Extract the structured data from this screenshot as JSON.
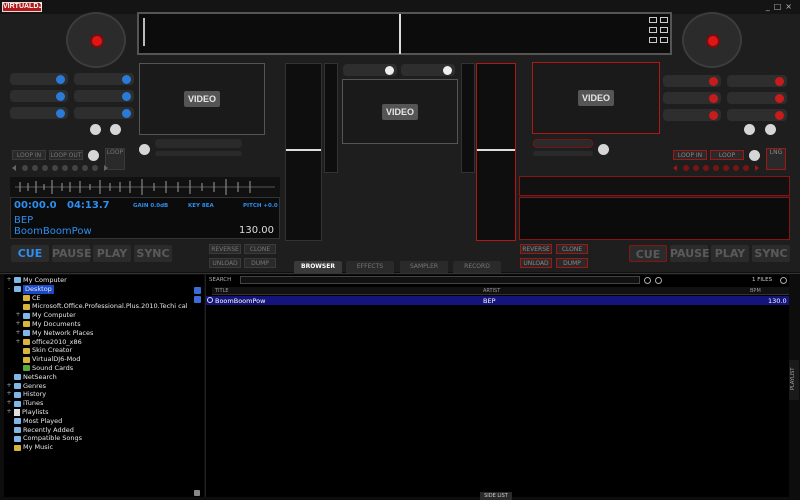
{
  "app": {
    "logo": "VIRTUALDJ",
    "window_controls": [
      "_",
      "□",
      "×"
    ]
  },
  "video_label": "VIDEO",
  "deck_left": {
    "elapsed": "00:00.0",
    "remain": "04:13.7",
    "gain": "GAIN 0.0dB",
    "key": "KEY 8EA",
    "pitch": "PITCH +0.0",
    "artist": "BEP",
    "title": "BoomBoomPow",
    "bpm": "130.00",
    "loop_in": "LOOP IN",
    "loop_out": "LOOP OUT",
    "loop": "LOOP",
    "reverse": "REVERSE",
    "clone": "CLONE",
    "unload": "UNLOAD",
    "dump": "DUMP",
    "cue": "CUE",
    "pause": "PAUSE",
    "play": "PLAY",
    "sync": "SYNC"
  },
  "deck_right": {
    "loop_in": "LOOP IN",
    "loop": "LOOP",
    "lng": "LNG",
    "reverse": "REVERSE",
    "clone": "CLONE",
    "unload": "UNLOAD",
    "dump": "DUMP",
    "cue": "CUE",
    "pause": "PAUSE",
    "play": "PLAY",
    "sync": "SYNC"
  },
  "tabs": [
    "BROWSER",
    "EFFECTS",
    "SAMPLER",
    "RECORD"
  ],
  "search": {
    "label": "SEARCH",
    "value": "",
    "files": "1 FILES"
  },
  "columns": [
    "TITLE",
    "ARTIST",
    "BPM"
  ],
  "rows": [
    {
      "title": "BoomBoomPow",
      "artist": "BEP",
      "bpm": "130.0"
    }
  ],
  "tree": [
    {
      "label": "My Computer",
      "indent": 0,
      "icon": "pc",
      "exp": "+"
    },
    {
      "label": "Desktop",
      "indent": 0,
      "icon": "pc",
      "exp": "-",
      "selected": true
    },
    {
      "label": "CE",
      "indent": 1,
      "icon": "folder",
      "exp": ""
    },
    {
      "label": "Microsoft.Office.Professional.Plus.2010.Techi cal",
      "indent": 1,
      "icon": "folder",
      "exp": ""
    },
    {
      "label": "My Computer",
      "indent": 1,
      "icon": "pc",
      "exp": "+"
    },
    {
      "label": "My Documents",
      "indent": 1,
      "icon": "folder",
      "exp": "+"
    },
    {
      "label": "My Network Places",
      "indent": 1,
      "icon": "pc",
      "exp": "+"
    },
    {
      "label": "office2010_x86",
      "indent": 1,
      "icon": "folder",
      "exp": "+"
    },
    {
      "label": "Skin Creator",
      "indent": 1,
      "icon": "folder",
      "exp": ""
    },
    {
      "label": "VirtualDJ6-Mod",
      "indent": 1,
      "icon": "folder",
      "exp": ""
    },
    {
      "label": "Sound Cards",
      "indent": 1,
      "icon": "green",
      "exp": ""
    },
    {
      "label": "NetSearch",
      "indent": 0,
      "icon": "pc",
      "exp": ""
    },
    {
      "label": "Genres",
      "indent": 0,
      "icon": "pc",
      "exp": "+"
    },
    {
      "label": "History",
      "indent": 0,
      "icon": "pc",
      "exp": "+"
    },
    {
      "label": "iTunes",
      "indent": 0,
      "icon": "pc",
      "exp": "+"
    },
    {
      "label": "Playlists",
      "indent": 0,
      "icon": "list",
      "exp": "+"
    },
    {
      "label": "Most Played",
      "indent": 0,
      "icon": "pc",
      "exp": ""
    },
    {
      "label": "Recently Added",
      "indent": 0,
      "icon": "pc",
      "exp": ""
    },
    {
      "label": "Compatible Songs",
      "indent": 0,
      "icon": "pc",
      "exp": ""
    },
    {
      "label": "My Music",
      "indent": 0,
      "icon": "folder",
      "exp": ""
    }
  ],
  "playlist_label": "PLAYLIST",
  "sidelist_label": "SIDE LIST",
  "colors": {
    "blue": "#2d8ef0",
    "red": "#c81b1b",
    "selected_row": "#14147a"
  }
}
